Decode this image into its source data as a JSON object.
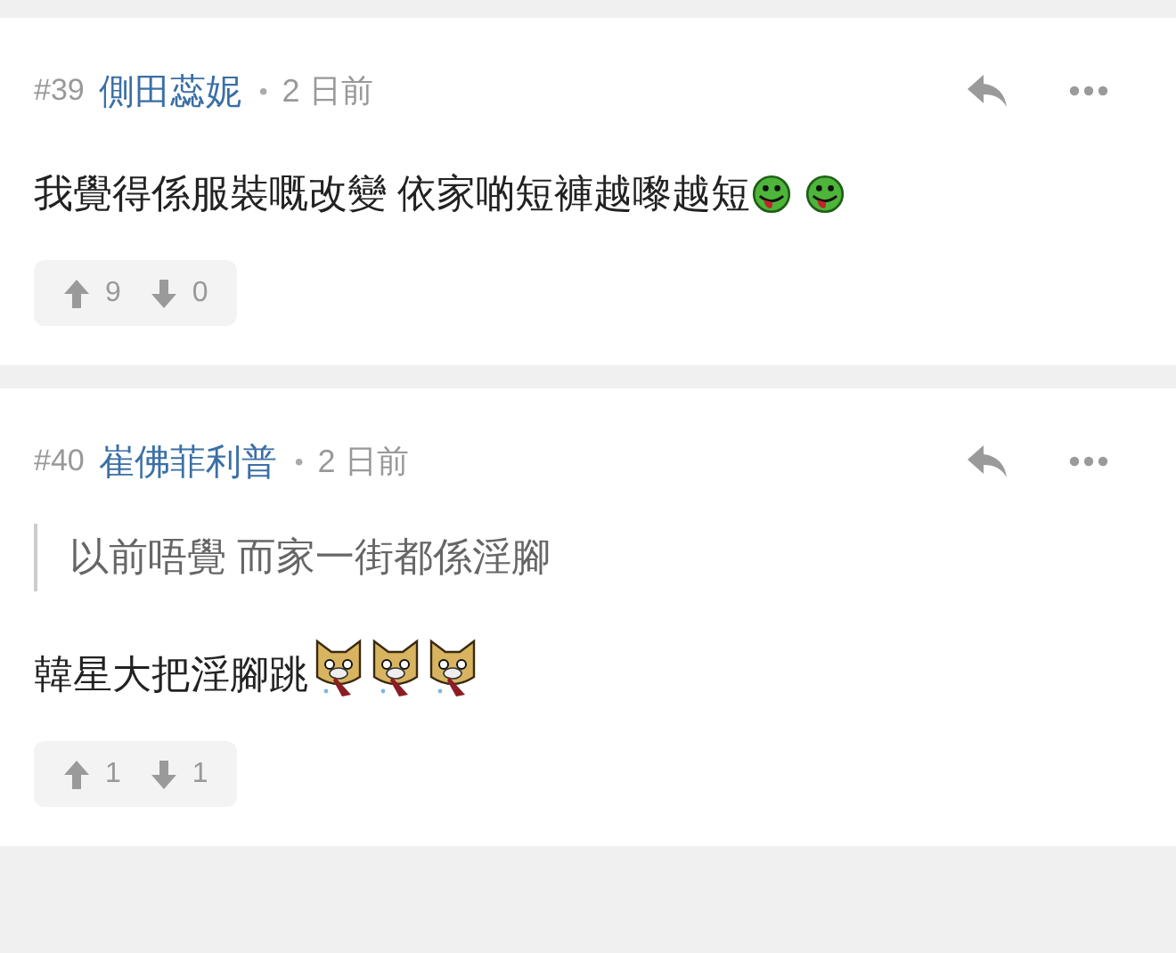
{
  "comments": [
    {
      "number": "#39",
      "author": "側田蕊妮",
      "separator": "•",
      "time": "2 日前",
      "body": [
        {
          "kind": "text",
          "text": "我覺得係服裝嘅改變 依家啲短褲越嚟越短"
        },
        {
          "kind": "tongue-emoji"
        },
        {
          "kind": "space"
        },
        {
          "kind": "tongue-emoji"
        }
      ],
      "upvotes": "9",
      "downvotes": "0"
    },
    {
      "number": "#40",
      "author": "崔佛菲利普",
      "separator": "•",
      "time": "2 日前",
      "quote": "以前唔覺 而家一街都係淫腳",
      "body": [
        {
          "kind": "text",
          "text": "韓星大把淫腳跳"
        },
        {
          "kind": "dog-emoji"
        },
        {
          "kind": "dog-emoji"
        },
        {
          "kind": "dog-emoji"
        }
      ],
      "upvotes": "1",
      "downvotes": "1"
    }
  ]
}
